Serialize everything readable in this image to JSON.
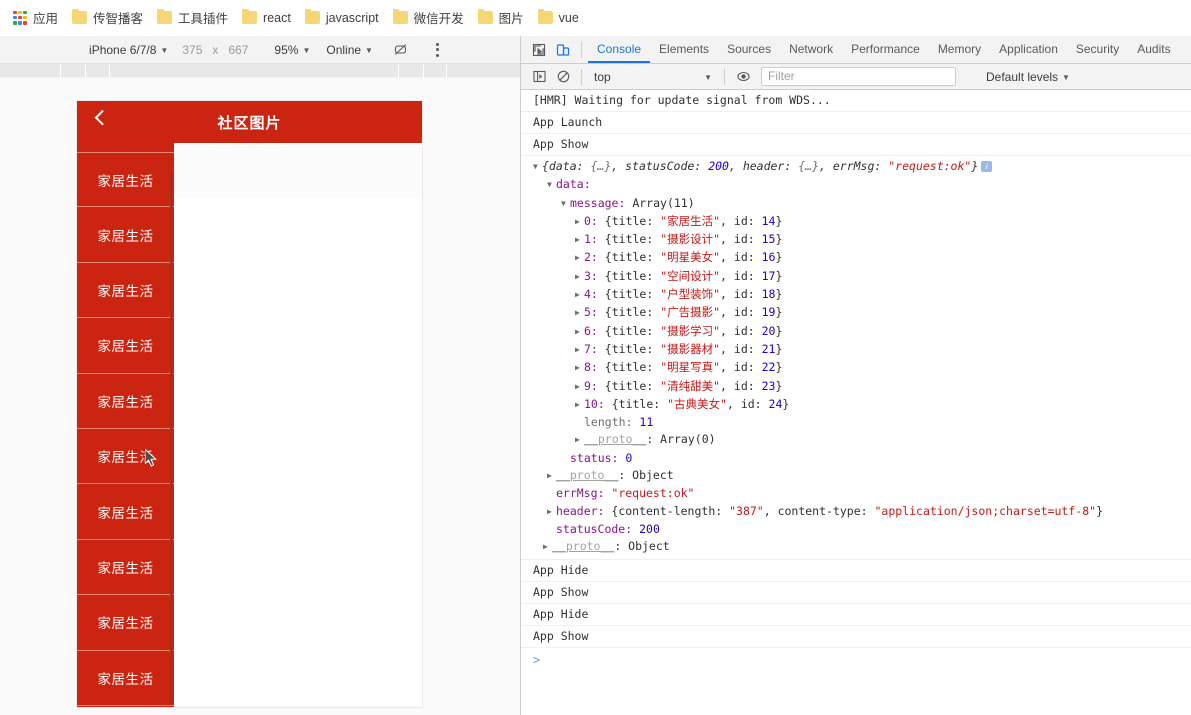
{
  "bookmarks": {
    "apps_label": "应用",
    "items": [
      {
        "label": "传智播客",
        "icon": "folder-icon"
      },
      {
        "label": "工具插件",
        "icon": "folder-icon"
      },
      {
        "label": "react",
        "icon": "folder-icon"
      },
      {
        "label": "javascript",
        "icon": "folder-icon"
      },
      {
        "label": "微信开发",
        "icon": "folder-icon"
      },
      {
        "label": "图片",
        "icon": "folder-icon"
      },
      {
        "label": "vue",
        "icon": "folder-icon"
      }
    ]
  },
  "device_toolbar": {
    "device": "iPhone 6/7/8",
    "width": "375",
    "times": "x",
    "height": "667",
    "zoom": "95%",
    "throttle": "Online",
    "rotate_icon": "rotate-icon",
    "menu_icon": "kebab-menu-icon"
  },
  "phone": {
    "header": {
      "back_icon": "back-chevron-icon",
      "title": "社区图片"
    },
    "side_items": [
      {
        "label": "家居生活"
      },
      {
        "label": "家居生活"
      },
      {
        "label": "家居生活"
      },
      {
        "label": "家居生活"
      },
      {
        "label": "家居生活"
      },
      {
        "label": "家居生活"
      },
      {
        "label": "家居生活"
      },
      {
        "label": "家居生活"
      },
      {
        "label": "家居生活"
      },
      {
        "label": "家居生活"
      }
    ],
    "accent_color": "#cb2410"
  },
  "devtools": {
    "inspect_icon": "inspect-element-icon",
    "device_toggle_icon": "device-toolbar-icon",
    "tabs": [
      {
        "label": "Console",
        "active": true
      },
      {
        "label": "Elements",
        "active": false
      },
      {
        "label": "Sources",
        "active": false
      },
      {
        "label": "Network",
        "active": false
      },
      {
        "label": "Performance",
        "active": false
      },
      {
        "label": "Memory",
        "active": false
      },
      {
        "label": "Application",
        "active": false
      },
      {
        "label": "Security",
        "active": false
      },
      {
        "label": "Audits",
        "active": false
      }
    ],
    "active_tab_color": "#1a73e8",
    "subbar": {
      "sidebar_icon": "console-sidebar-icon",
      "clear_icon": "clear-console-icon",
      "context": "top",
      "eye_icon": "live-expression-icon",
      "filter_placeholder": "Filter",
      "filter_value": "",
      "levels": "Default levels"
    },
    "console": {
      "top_messages": [
        "[HMR] Waiting for update signal from WDS...",
        "App Launch",
        "App Show"
      ],
      "object_summary": {
        "prefix": "{data: ",
        "data_collapsed": "{…}",
        "sep1": ", statusCode: ",
        "status_code": "200",
        "sep2": ", header: ",
        "header_collapsed": "{…}",
        "sep3": ", errMsg: ",
        "err_msg": "\"request:ok\"",
        "suffix": "}",
        "badge": "i"
      },
      "tree": {
        "data_key": "data:",
        "message_key": "message:",
        "message_type": "Array(11)",
        "array_items": [
          {
            "index": "0:",
            "open": "{title: ",
            "title": "\"家居生活\"",
            "mid": ", id: ",
            "id": "14",
            "close": "}"
          },
          {
            "index": "1:",
            "open": "{title: ",
            "title": "\"摄影设计\"",
            "mid": ", id: ",
            "id": "15",
            "close": "}"
          },
          {
            "index": "2:",
            "open": "{title: ",
            "title": "\"明星美女\"",
            "mid": ", id: ",
            "id": "16",
            "close": "}"
          },
          {
            "index": "3:",
            "open": "{title: ",
            "title": "\"空间设计\"",
            "mid": ", id: ",
            "id": "17",
            "close": "}"
          },
          {
            "index": "4:",
            "open": "{title: ",
            "title": "\"户型装饰\"",
            "mid": ", id: ",
            "id": "18",
            "close": "}"
          },
          {
            "index": "5:",
            "open": "{title: ",
            "title": "\"广告摄影\"",
            "mid": ", id: ",
            "id": "19",
            "close": "}"
          },
          {
            "index": "6:",
            "open": "{title: ",
            "title": "\"摄影学习\"",
            "mid": ", id: ",
            "id": "20",
            "close": "}"
          },
          {
            "index": "7:",
            "open": "{title: ",
            "title": "\"摄影器材\"",
            "mid": ", id: ",
            "id": "21",
            "close": "}"
          },
          {
            "index": "8:",
            "open": "{title: ",
            "title": "\"明星写真\"",
            "mid": ", id: ",
            "id": "22",
            "close": "}"
          },
          {
            "index": "9:",
            "open": "{title: ",
            "title": "\"清纯甜美\"",
            "mid": ", id: ",
            "id": "23",
            "close": "}"
          },
          {
            "index": "10:",
            "open": "{title: ",
            "title": "\"古典美女\"",
            "mid": ", id: ",
            "id": "24",
            "close": "}"
          }
        ],
        "length_key": "length: ",
        "length_value": "11",
        "array_proto_key": "__proto__",
        "array_proto_value": ": Array(0)",
        "status_key": "status: ",
        "status_value": "0",
        "data_proto_key": "__proto__",
        "data_proto_value": ": Object",
        "errmsg_key": "errMsg: ",
        "errmsg_value": "\"request:ok\"",
        "header_key": "header: ",
        "header_open": "{content-length: ",
        "header_len": "\"387\"",
        "header_mid": ", content-type: ",
        "header_type": "\"application/json;charset=utf-8\"",
        "header_close": "}",
        "statuscode_key": "statusCode: ",
        "statuscode_value": "200",
        "root_proto_key": "__proto__",
        "root_proto_value": ": Object"
      },
      "bottom_messages": [
        "App Hide",
        "App Show",
        "App Hide",
        "App Show"
      ],
      "prompt": ">"
    }
  }
}
